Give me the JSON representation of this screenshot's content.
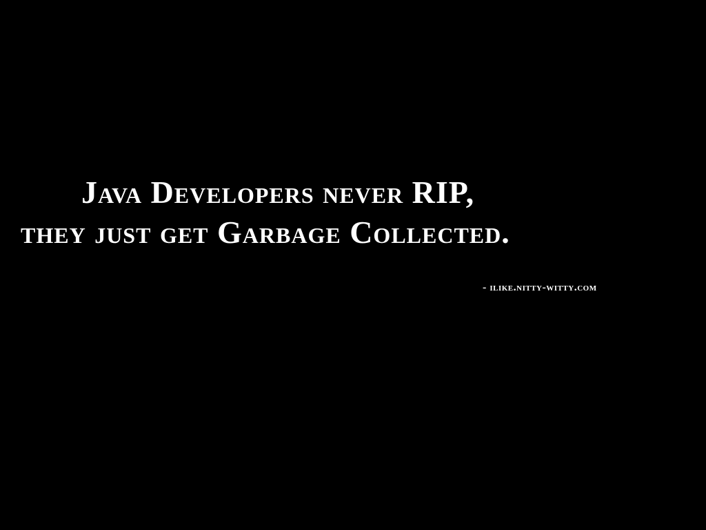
{
  "quote": {
    "line1": "Java Developers never RIP,",
    "line2": "they just get Garbage Collected."
  },
  "attribution": "- ilike.nitty-witty.com",
  "colors": {
    "background": "#000000",
    "text": "#ffffff"
  }
}
